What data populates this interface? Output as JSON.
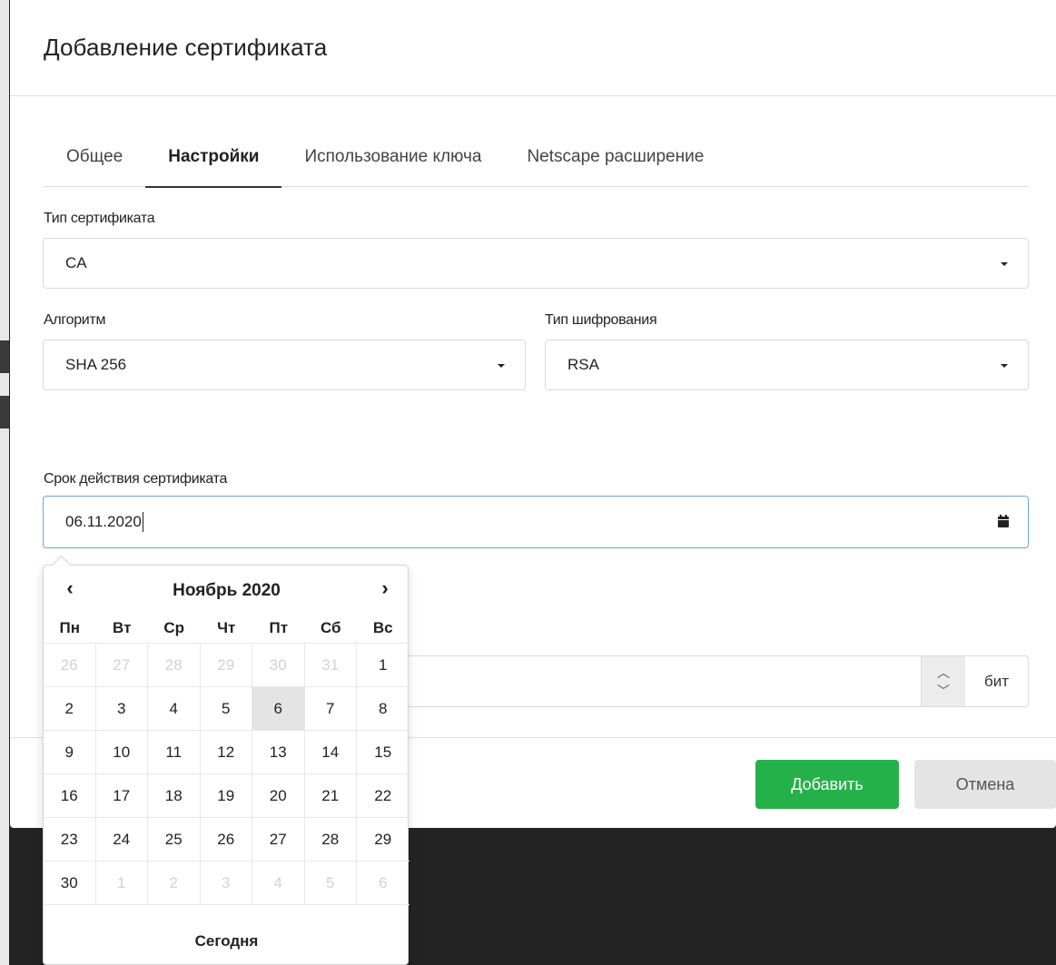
{
  "modal": {
    "title": "Добавление сертификата",
    "tabs": [
      {
        "label": "Общее",
        "active": false
      },
      {
        "label": "Настройки",
        "active": true
      },
      {
        "label": "Использование ключа",
        "active": false
      },
      {
        "label": "Netscape расширение",
        "active": false
      }
    ]
  },
  "form": {
    "cert_type": {
      "label": "Тип сертификата",
      "value": "CA"
    },
    "algorithm": {
      "label": "Алгоритм",
      "value": "SHA 256"
    },
    "encryption": {
      "label": "Тип шифрования",
      "value": "RSA"
    },
    "validity": {
      "label": "Срок действия сертификата",
      "value": "06.11.2020"
    },
    "key_size": {
      "value": "",
      "unit": "бит"
    }
  },
  "datepicker": {
    "prev": "‹",
    "next": "›",
    "title": "Ноябрь 2020",
    "weekdays": [
      "Пн",
      "Вт",
      "Ср",
      "Чт",
      "Пт",
      "Сб",
      "Вс"
    ],
    "weeks": [
      [
        {
          "d": "26",
          "m": true
        },
        {
          "d": "27",
          "m": true
        },
        {
          "d": "28",
          "m": true
        },
        {
          "d": "29",
          "m": true
        },
        {
          "d": "30",
          "m": true
        },
        {
          "d": "31",
          "m": true
        },
        {
          "d": "1",
          "m": false
        }
      ],
      [
        {
          "d": "2",
          "m": false
        },
        {
          "d": "3",
          "m": false
        },
        {
          "d": "4",
          "m": false
        },
        {
          "d": "5",
          "m": false
        },
        {
          "d": "6",
          "m": false,
          "selected": true
        },
        {
          "d": "7",
          "m": false
        },
        {
          "d": "8",
          "m": false
        }
      ],
      [
        {
          "d": "9",
          "m": false
        },
        {
          "d": "10",
          "m": false
        },
        {
          "d": "11",
          "m": false
        },
        {
          "d": "12",
          "m": false
        },
        {
          "d": "13",
          "m": false
        },
        {
          "d": "14",
          "m": false
        },
        {
          "d": "15",
          "m": false
        }
      ],
      [
        {
          "d": "16",
          "m": false
        },
        {
          "d": "17",
          "m": false
        },
        {
          "d": "18",
          "m": false
        },
        {
          "d": "19",
          "m": false
        },
        {
          "d": "20",
          "m": false
        },
        {
          "d": "21",
          "m": false
        },
        {
          "d": "22",
          "m": false
        }
      ],
      [
        {
          "d": "23",
          "m": false
        },
        {
          "d": "24",
          "m": false
        },
        {
          "d": "25",
          "m": false
        },
        {
          "d": "26",
          "m": false
        },
        {
          "d": "27",
          "m": false
        },
        {
          "d": "28",
          "m": false
        },
        {
          "d": "29",
          "m": false
        }
      ],
      [
        {
          "d": "30",
          "m": false
        },
        {
          "d": "1",
          "m": true
        },
        {
          "d": "2",
          "m": true
        },
        {
          "d": "3",
          "m": true
        },
        {
          "d": "4",
          "m": true
        },
        {
          "d": "5",
          "m": true
        },
        {
          "d": "6",
          "m": true
        }
      ]
    ],
    "today_label": "Сегодня"
  },
  "buttons": {
    "add": "Добавить",
    "cancel": "Отмена"
  },
  "colors": {
    "primary": "#25b14a",
    "focus_border": "#6aa7d6",
    "overlay": "#232323"
  }
}
